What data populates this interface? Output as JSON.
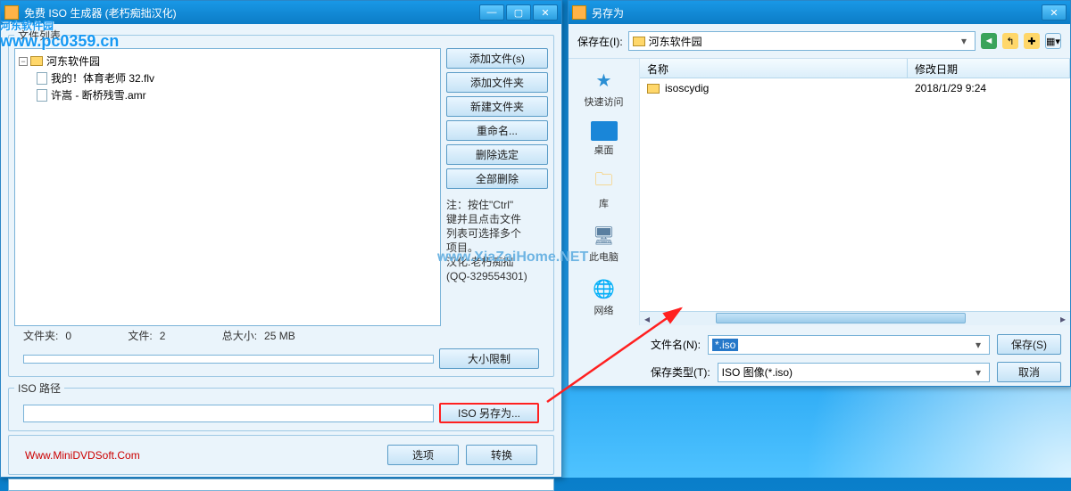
{
  "watermark": {
    "main": "河东软件园",
    "sub": "www.pc0359.cn",
    "center": "www.XiaZaiHome.NET"
  },
  "iso": {
    "title": "免费 ISO 生成器 (老朽痴拙汉化)",
    "group_label": "文件列表",
    "tree": {
      "root": "河东软件园",
      "file1": "我的！体育老师 32.flv",
      "file2": "许嵩 - 断桥残雪.amr"
    },
    "buttons": {
      "add_files": "添加文件(s)",
      "add_folder": "添加文件夹",
      "new_folder": "新建文件夹",
      "rename": "重命名...",
      "delete_sel": "删除选定",
      "delete_all": "全部删除",
      "size_limit": "大小限制",
      "iso_save_as": "ISO 另存为...",
      "options": "选项",
      "convert": "转换"
    },
    "note_l1": "注：按住\"Ctrl\"",
    "note_l2": "键并且点击文件",
    "note_l3": "列表可选择多个",
    "note_l4": "项目。",
    "note_l5": "汉化:老朽痴拙",
    "note_l6": "(QQ-329554301)",
    "stats": {
      "folders_l": "文件夹:",
      "folders_v": "0",
      "files_l": "文件:",
      "files_v": "2",
      "size_l": "总大小:",
      "size_v": "25 MB"
    },
    "iso_path_label": "ISO 路径",
    "link": "Www.MiniDVDSoft.Com"
  },
  "save": {
    "title": "另存为",
    "save_in_label": "保存在(I):",
    "save_in_value": "河东软件园",
    "cols": {
      "name": "名称",
      "date": "修改日期"
    },
    "row": {
      "name": "isoscydig",
      "date": "2018/1/29 9:24"
    },
    "places": {
      "quick": "快速访问",
      "desktop": "桌面",
      "library": "库",
      "thispc": "此电脑",
      "network": "网络"
    },
    "filename_label": "文件名(N):",
    "filename_value": "*.iso",
    "filetype_label": "保存类型(T):",
    "filetype_value": "ISO 图像(*.iso)",
    "save_btn": "保存(S)",
    "cancel_btn": "取消"
  }
}
